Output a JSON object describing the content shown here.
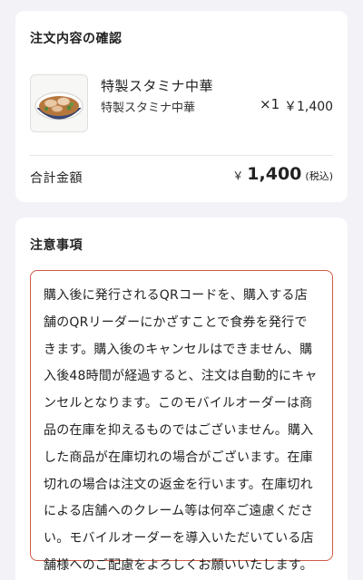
{
  "order": {
    "title": "注文内容の確認",
    "item": {
      "name": "特製スタミナ中華",
      "option": "特製スタミナ中華",
      "qty": "×1",
      "price": "￥1,400",
      "image_icon": "ramen-bowl-image"
    },
    "total": {
      "label": "合計金額",
      "currency": "￥",
      "amount": "1,400",
      "tax_note": "(税込)"
    }
  },
  "notes": {
    "title": "注意事項",
    "text": "購入後に発行されるQRコードを、購入する店舗のQRリーダーにかざすことで食券を発行できます。購入後のキャンセルはできません、購入後48時間が経過すると、注文は自動的にキャンセルとなります。このモバイルオーダーは商品の在庫を抑えるものではございません。購入した商品が在庫切れの場合がございます。在庫切れの場合は注文の返金を行います。在庫切れによる店舗へのクレーム等は何卒ご遠慮ください。モバイルオーダーを導入いただいている店舗様へのご配慮をよろしくお願いいたします。",
    "border_color": "#cd5b45"
  }
}
